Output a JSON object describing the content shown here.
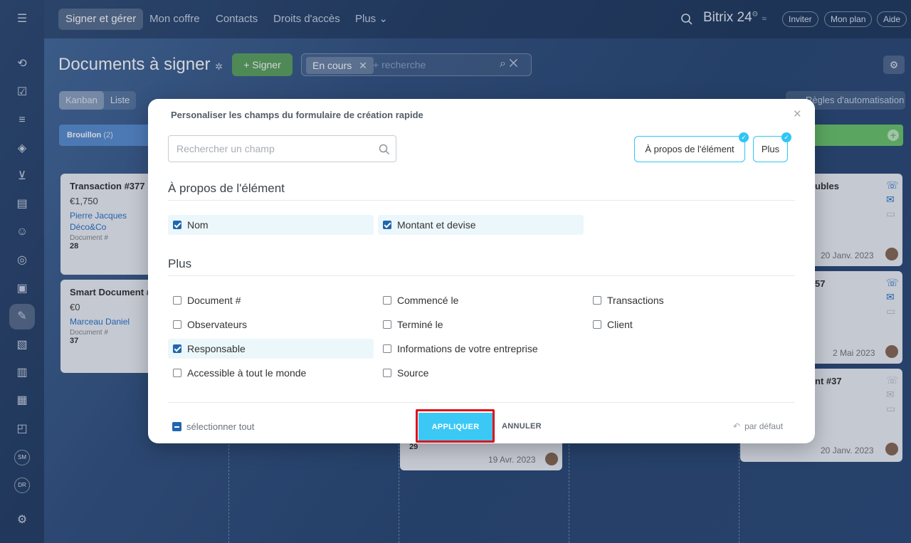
{
  "topnav": {
    "items": [
      "Signer et gérer",
      "Mon coffre",
      "Contacts",
      "Droits d'accès",
      "Plus ⌄"
    ],
    "brand": "Bitrix 24",
    "brand_sup": "⊙",
    "invite": "Inviter",
    "plan": "Mon plan",
    "help": "Aide"
  },
  "page": {
    "title": "Documents à signer",
    "sign_button": "+ Signer",
    "filter_tag": "En cours",
    "filter_placeholder": "+ recherche",
    "view_kanban": "Kanban",
    "view_list": "Liste",
    "rules": "Règles d'automatisation"
  },
  "kanban": {
    "col1_title": "Brouillon",
    "col1_count": "(2)",
    "cards": [
      {
        "title": "Transaction #377",
        "amount": "€1,750",
        "link1": "Pierre Jacques",
        "link2": "Déco&Co",
        "sub": "Document #",
        "num": "28"
      },
      {
        "title": "Smart Document #",
        "amount": "€0",
        "link1": "Marceau Daniel",
        "sub": "Document #",
        "num": "37"
      }
    ],
    "mid_card": {
      "num": "29",
      "date": "19 Avr. 2023"
    },
    "right_cards": [
      {
        "title": "ubles",
        "date": "20 Janv. 2023"
      },
      {
        "title": "57",
        "date": "2 Mai 2023"
      },
      {
        "title": "nt #37",
        "date": "20 Janv. 2023"
      }
    ]
  },
  "avatars": {
    "sm": "SM",
    "dr": "DR"
  },
  "modal": {
    "title": "Personaliser les champs du formulaire de création rapide",
    "search_placeholder": "Rechercher un champ",
    "chips": [
      "À propos de l'élément",
      "Plus"
    ],
    "section1": "À propos de l'élément",
    "section1_fields": [
      {
        "label": "Nom",
        "checked": true
      },
      {
        "label": "Montant et devise",
        "checked": true
      }
    ],
    "section2": "Plus",
    "section2_fields": [
      {
        "label": "Document #",
        "checked": false
      },
      {
        "label": "Commencé le",
        "checked": false
      },
      {
        "label": "Transactions",
        "checked": false
      },
      {
        "label": "Observateurs",
        "checked": false
      },
      {
        "label": "Terminé le",
        "checked": false
      },
      {
        "label": "Client",
        "checked": false
      },
      {
        "label": "Responsable",
        "checked": true
      },
      {
        "label": "Informations de votre entreprise",
        "checked": false
      },
      {
        "label": "Accessible à tout le monde",
        "checked": false
      },
      {
        "label": "Source",
        "checked": false
      }
    ],
    "select_all": "sélectionner tout",
    "apply": "APPLIQUER",
    "cancel": "ANNULER",
    "reset": "par défaut"
  },
  "colors": {
    "accent": "#3bc8f5",
    "checkbox": "#2066b0",
    "highlight": "#e0101b",
    "sign_green": "#5ea35f"
  }
}
